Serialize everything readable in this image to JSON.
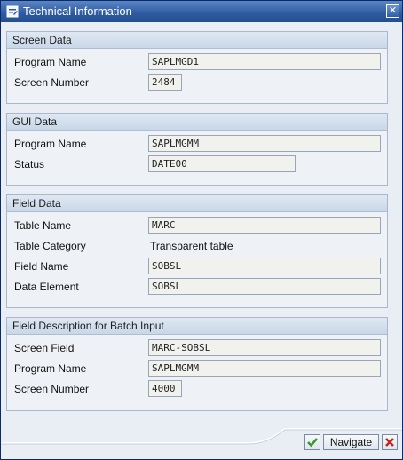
{
  "window": {
    "title": "Technical Information",
    "close_glyph": "✕"
  },
  "groups": {
    "screen_data": {
      "title": "Screen Data",
      "program_name_label": "Program Name",
      "program_name_value": "SAPLMGD1",
      "screen_number_label": "Screen Number",
      "screen_number_value": "2484"
    },
    "gui_data": {
      "title": "GUI Data",
      "program_name_label": "Program Name",
      "program_name_value": "SAPLMGMM",
      "status_label": "Status",
      "status_value": "DATE00"
    },
    "field_data": {
      "title": "Field Data",
      "table_name_label": "Table Name",
      "table_name_value": "MARC",
      "table_category_label": "Table Category",
      "table_category_value": "Transparent table",
      "field_name_label": "Field Name",
      "field_name_value": "SOBSL",
      "data_element_label": "Data Element",
      "data_element_value": "SOBSL"
    },
    "batch_input": {
      "title": "Field Description for Batch Input",
      "screen_field_label": "Screen Field",
      "screen_field_value": "MARC-SOBSL",
      "program_name_label": "Program Name",
      "program_name_value": "SAPLMGMM",
      "screen_number_label": "Screen Number",
      "screen_number_value": "4000"
    }
  },
  "footer": {
    "navigate_label": "Navigate"
  },
  "icons": {
    "title": "window-info-icon",
    "ok": "check-icon",
    "cancel": "cancel-x-icon"
  },
  "colors": {
    "titlebar": "#2d5aa0",
    "ok_green": "#3a9a2a",
    "cancel_red": "#c0281e"
  }
}
